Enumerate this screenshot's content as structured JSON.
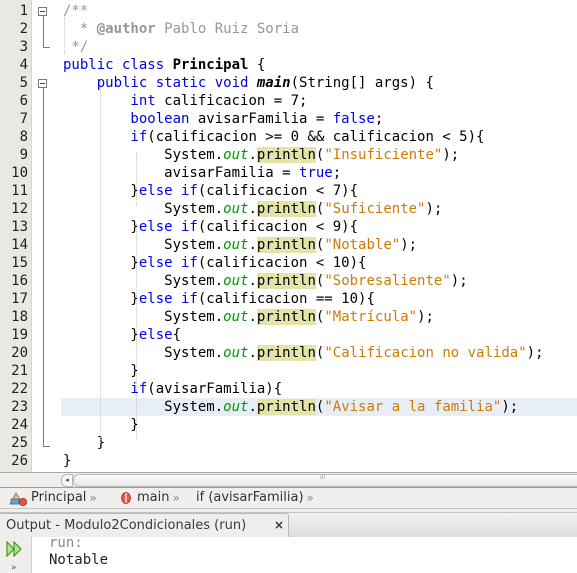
{
  "editor": {
    "line_numbers": [
      "1",
      "2",
      "3",
      "4",
      "5",
      "6",
      "7",
      "8",
      "9",
      "10",
      "11",
      "12",
      "13",
      "14",
      "15",
      "16",
      "17",
      "18",
      "19",
      "20",
      "21",
      "22",
      "23",
      "24",
      "25",
      "26"
    ],
    "current_line": 23,
    "lines": [
      [
        {
          "t": "/**",
          "c": "cm"
        }
      ],
      [
        {
          "t": "  * ",
          "c": "cm"
        },
        {
          "t": "@author",
          "c": "cmb"
        },
        {
          "t": " Pablo Ruiz Soria",
          "c": "cm"
        }
      ],
      [
        {
          "t": " */",
          "c": "cm"
        }
      ],
      [
        {
          "t": "public class ",
          "c": "kw"
        },
        {
          "t": "Principal",
          "c": "bold"
        },
        {
          "t": " {",
          "c": ""
        }
      ],
      [
        {
          "t": "    public static void ",
          "c": "kw"
        },
        {
          "t": "main",
          "c": "boldit"
        },
        {
          "t": "(String[] args) {",
          "c": ""
        }
      ],
      [
        {
          "t": "        int ",
          "c": "kw"
        },
        {
          "t": "calificacion = 7;",
          "c": ""
        }
      ],
      [
        {
          "t": "        boolean ",
          "c": "kw"
        },
        {
          "t": "avisarFamilia = ",
          "c": ""
        },
        {
          "t": "false",
          "c": "kw"
        },
        {
          "t": ";",
          "c": ""
        }
      ],
      [
        {
          "t": "        if",
          "c": "kw"
        },
        {
          "t": "(calificacion >= 0 && calificacion < 5){",
          "c": ""
        }
      ],
      [
        {
          "t": "            System.",
          "c": ""
        },
        {
          "t": "out",
          "c": "fld"
        },
        {
          "t": ".",
          "c": ""
        },
        {
          "t": "println",
          "c": "hl"
        },
        {
          "t": "(",
          "c": ""
        },
        {
          "t": "\"Insuficiente\"",
          "c": "st"
        },
        {
          "t": ");",
          "c": ""
        }
      ],
      [
        {
          "t": "            avisarFamilia = ",
          "c": ""
        },
        {
          "t": "true",
          "c": "kw"
        },
        {
          "t": ";",
          "c": ""
        }
      ],
      [
        {
          "t": "        }",
          "c": ""
        },
        {
          "t": "else if",
          "c": "kw"
        },
        {
          "t": "(calificacion < 7){",
          "c": ""
        }
      ],
      [
        {
          "t": "            System.",
          "c": ""
        },
        {
          "t": "out",
          "c": "fld"
        },
        {
          "t": ".",
          "c": ""
        },
        {
          "t": "println",
          "c": "hl"
        },
        {
          "t": "(",
          "c": ""
        },
        {
          "t": "\"Suficiente\"",
          "c": "st"
        },
        {
          "t": ");",
          "c": ""
        }
      ],
      [
        {
          "t": "        }",
          "c": ""
        },
        {
          "t": "else if",
          "c": "kw"
        },
        {
          "t": "(calificacion < 9){",
          "c": ""
        }
      ],
      [
        {
          "t": "            System.",
          "c": ""
        },
        {
          "t": "out",
          "c": "fld"
        },
        {
          "t": ".",
          "c": ""
        },
        {
          "t": "println",
          "c": "hl"
        },
        {
          "t": "(",
          "c": ""
        },
        {
          "t": "\"Notable\"",
          "c": "st"
        },
        {
          "t": ");",
          "c": ""
        }
      ],
      [
        {
          "t": "        }",
          "c": ""
        },
        {
          "t": "else if",
          "c": "kw"
        },
        {
          "t": "(calificacion < 10){",
          "c": ""
        }
      ],
      [
        {
          "t": "            System.",
          "c": ""
        },
        {
          "t": "out",
          "c": "fld"
        },
        {
          "t": ".",
          "c": ""
        },
        {
          "t": "println",
          "c": "hl"
        },
        {
          "t": "(",
          "c": ""
        },
        {
          "t": "\"Sobresaliente\"",
          "c": "st"
        },
        {
          "t": ");",
          "c": ""
        }
      ],
      [
        {
          "t": "        }",
          "c": ""
        },
        {
          "t": "else if",
          "c": "kw"
        },
        {
          "t": "(calificacion == 10){",
          "c": ""
        }
      ],
      [
        {
          "t": "            System.",
          "c": ""
        },
        {
          "t": "out",
          "c": "fld"
        },
        {
          "t": ".",
          "c": ""
        },
        {
          "t": "println",
          "c": "hl"
        },
        {
          "t": "(",
          "c": ""
        },
        {
          "t": "\"Matrícula\"",
          "c": "st"
        },
        {
          "t": ");",
          "c": ""
        }
      ],
      [
        {
          "t": "        }",
          "c": ""
        },
        {
          "t": "else",
          "c": "kw"
        },
        {
          "t": "{",
          "c": ""
        }
      ],
      [
        {
          "t": "            System.",
          "c": ""
        },
        {
          "t": "out",
          "c": "fld"
        },
        {
          "t": ".",
          "c": ""
        },
        {
          "t": "println",
          "c": "hl"
        },
        {
          "t": "(",
          "c": ""
        },
        {
          "t": "\"Calificacion no valida\"",
          "c": "st"
        },
        {
          "t": ");",
          "c": ""
        }
      ],
      [
        {
          "t": "        }",
          "c": ""
        }
      ],
      [
        {
          "t": "        if",
          "c": "kw"
        },
        {
          "t": "(avisarFamilia){",
          "c": ""
        }
      ],
      [
        {
          "t": "            System.",
          "c": ""
        },
        {
          "t": "out",
          "c": "fld"
        },
        {
          "t": ".",
          "c": ""
        },
        {
          "t": "println",
          "c": "hl"
        },
        {
          "t": "(",
          "c": ""
        },
        {
          "t": "\"Avisar a la familia\"",
          "c": "st"
        },
        {
          "t": ");",
          "c": ""
        }
      ],
      [
        {
          "t": "        }",
          "c": ""
        }
      ],
      [
        {
          "t": "    }",
          "c": ""
        }
      ],
      [
        {
          "t": "}",
          "c": ""
        }
      ]
    ]
  },
  "breadcrumb": {
    "items": [
      {
        "label": "Principal",
        "icon": "class-icon"
      },
      {
        "label": "main",
        "icon": "method-icon"
      },
      {
        "label": "if (avisarFamilia)",
        "icon": ""
      }
    ],
    "separator": "»"
  },
  "output": {
    "tab_label": "Output - Modulo2Condicionales (run)",
    "close_glyph": "×",
    "lines": [
      "run:",
      "Notable"
    ],
    "rerun_glyph": "»"
  },
  "scrollbar": {
    "left_arrow": "◂",
    "grip": "III"
  },
  "colors": {
    "keyword": "#0000e6",
    "comment": "#969696",
    "string": "#ce7b00",
    "field": "#009900",
    "method_highlight": "#e4e4a8",
    "current_line": "#e8eef8"
  }
}
